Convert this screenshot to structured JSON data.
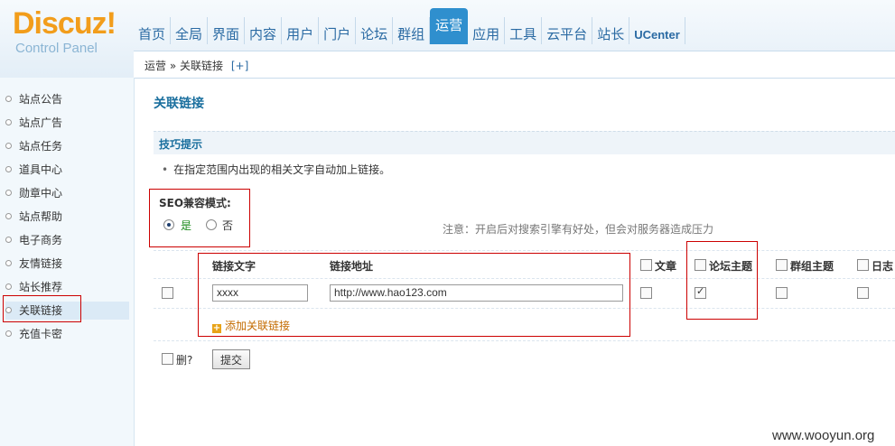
{
  "logo": {
    "main": "Discuz!",
    "sub": "Control Panel"
  },
  "nav": {
    "items": [
      "首页",
      "全局",
      "界面",
      "内容",
      "用户",
      "门户",
      "论坛",
      "群组",
      "运营",
      "应用",
      "工具",
      "云平台",
      "站长",
      "UCenter"
    ],
    "active": "运营"
  },
  "breadcrumb": {
    "section": "运营",
    "separator": "»",
    "page": "关联链接",
    "add": "[+]"
  },
  "sidebar": {
    "items": [
      "站点公告",
      "站点广告",
      "站点任务",
      "道具中心",
      "勋章中心",
      "站点帮助",
      "电子商务",
      "友情链接",
      "站长推荐",
      "关联链接",
      "充值卡密"
    ],
    "active": "关联链接"
  },
  "page_title": "关联链接",
  "tips": {
    "label": "技巧提示",
    "bullet": "•",
    "text": "在指定范围内出现的相关文字自动加上链接。"
  },
  "seo": {
    "label": "SEO兼容模式:",
    "yes": "是",
    "no": "否",
    "selected": "是",
    "note": "注意：开启后对搜索引擎有好处，但会对服务器造成压力"
  },
  "table": {
    "headers": {
      "text": "链接文字",
      "url": "链接地址",
      "article": "文章",
      "forum": "论坛主题",
      "group": "群组主题",
      "blog": "日志"
    },
    "row": {
      "text": "xxxx",
      "url": "http://www.hao123.com",
      "article": false,
      "forum": true,
      "group": false,
      "blog": false,
      "delete": false
    },
    "add_link": "添加关联链接"
  },
  "footer": {
    "delete_label": "删?",
    "submit": "提交"
  },
  "watermark": "www.wooyun.org",
  "colors": {
    "logo": "#f29d1b",
    "nav_active": "#2f8fce",
    "title": "#1a6f9e",
    "annotation": "#cc0000"
  }
}
